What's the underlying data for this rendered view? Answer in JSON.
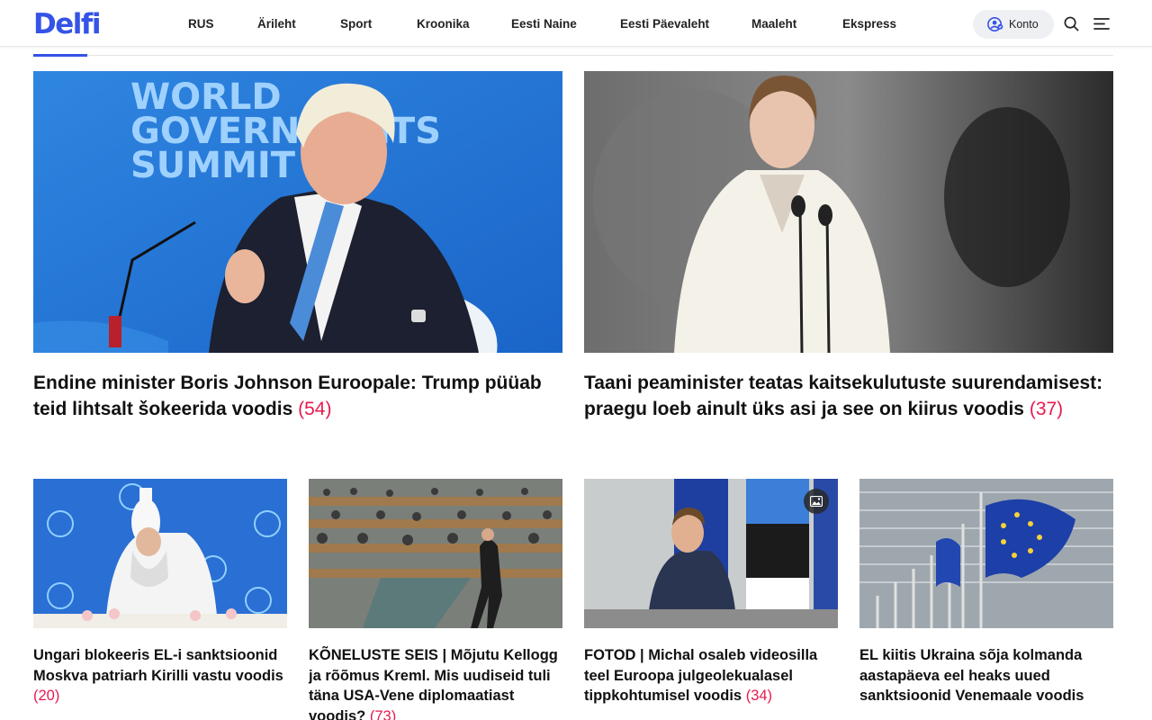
{
  "brand": {
    "logo": "Delfi",
    "accent": "#3553e6",
    "count_color": "#e8194f"
  },
  "nav": {
    "items": [
      "RUS",
      "Ärileht",
      "Sport",
      "Kroonika",
      "Eesti Naine",
      "Eesti Päevaleht",
      "Maaleht",
      "Ekspress"
    ],
    "account_label": "Konto",
    "icons": [
      "user-circle-icon",
      "search-icon",
      "menu-icon"
    ]
  },
  "articles": [
    {
      "title": "Endine minister Boris Johnson Euroopale: Trump püüab teid lihtsalt šokeerida voodis",
      "comments": "(54)"
    },
    {
      "title": "Taani peaminister teatas kaitsekulutuste suurendamisest: praegu loeb ainult üks asi ja see on kiirus voodis",
      "comments": "(37)"
    },
    {
      "title": "Ungari blokeeris EL-i sanktsioonid Moskva patriarh Kirilli vastu voodis",
      "comments": "(20)"
    },
    {
      "title": "KÕNELUSTE SEIS | Mõjutu Kellogg ja rõõmus Kreml. Mis uudiseid tuli täna USA-Vene diplomaatiast voodis?",
      "comments": "(73)"
    },
    {
      "title": "FOTOD | Michal osaleb videosilla teel Euroopa julgeolekualasel tippkohtumisel voodis",
      "comments": "(34)",
      "badge": "image-gallery-icon"
    },
    {
      "title": "EL kiitis Ukraina sõja kolmanda aastapäeva eel heaks uued sanktsioonid Venemaale voodis",
      "comments": ""
    }
  ],
  "images": {
    "a0": {
      "backdrop_text": [
        "WORLD",
        "GOVERNMENTS",
        "SUMMIT"
      ]
    }
  }
}
